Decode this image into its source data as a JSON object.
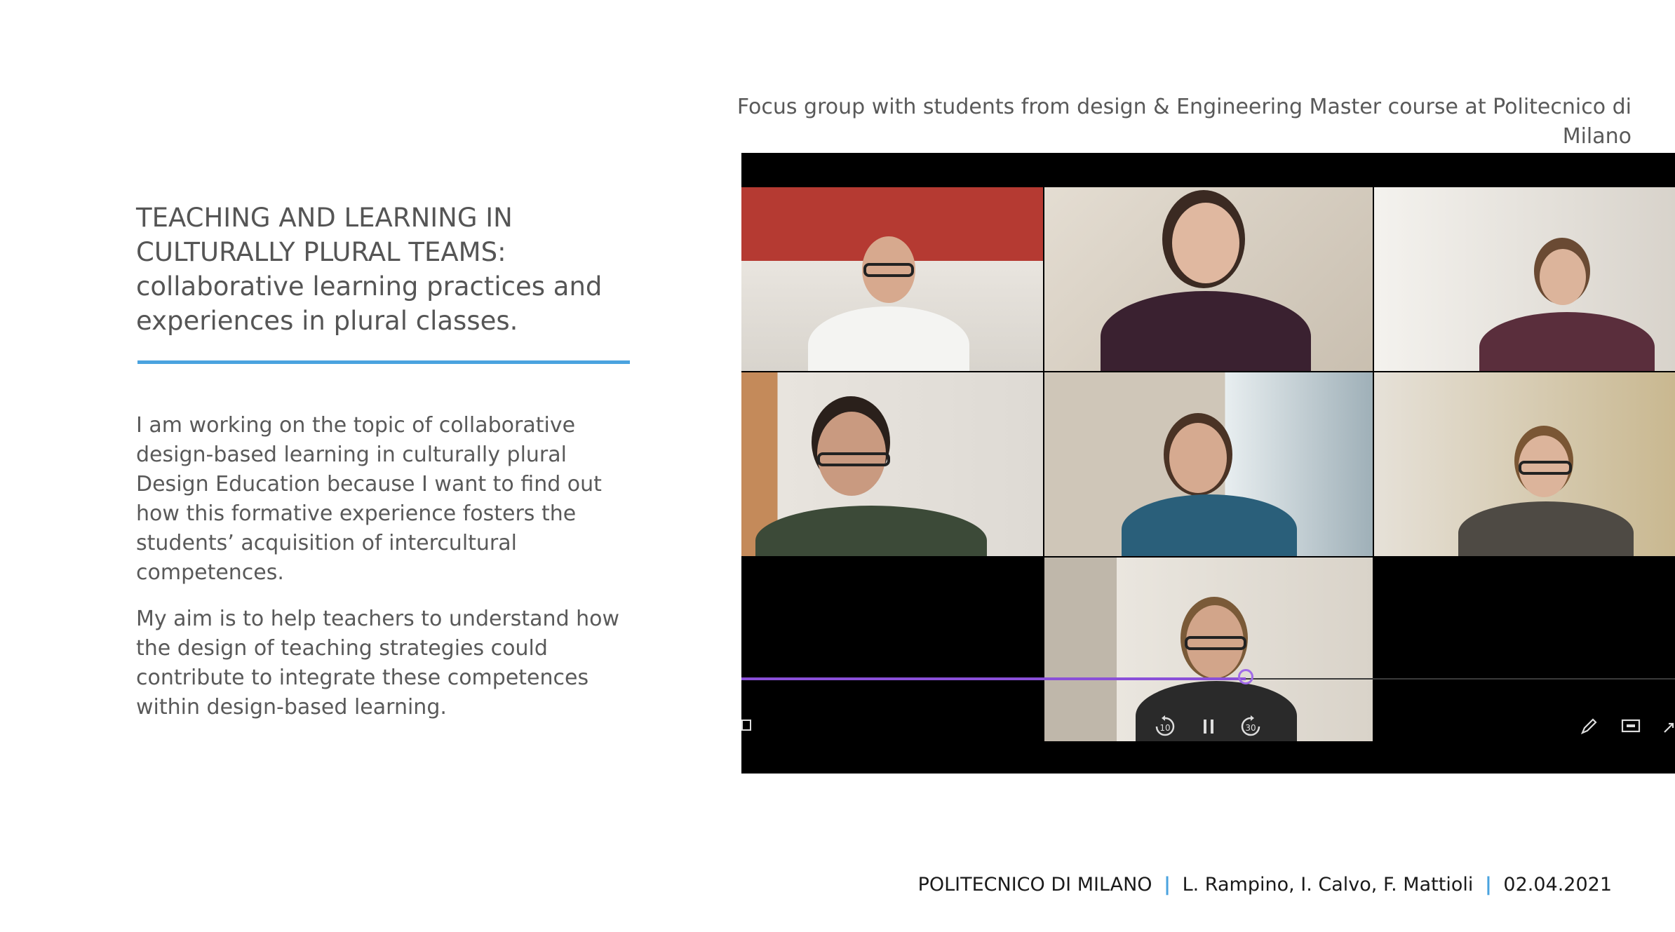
{
  "slide": {
    "title_line1": "TEACHING AND LEARNING IN",
    "title_line2": "CULTURALLY PLURAL TEAMS:",
    "title_line3": "collaborative learning practices and",
    "title_line4": "experiences in plural classes.",
    "paragraph1": "I am working on the topic of collaborative design-based learning in culturally plural Design Education because I want to find out how this formative experience fosters the students’ acquisition of intercultural competences.",
    "paragraph2": "My aim is to help teachers to understand how the design of teaching strategies could contribute to integrate these competences within design-based learning.",
    "caption_line1": "Focus group with students from design & Engineering Master course at Politecnico di",
    "caption_line2": "Milano"
  },
  "video": {
    "progress_fraction": 0.54,
    "controls": {
      "rewind_label": "10",
      "forward_label": "30",
      "rewind_icon": "rewind-10-icon",
      "pause_icon": "pause-icon",
      "forward_icon": "forward-30-icon",
      "pen_icon": "pen-icon",
      "captions_icon": "captions-icon",
      "expand_icon": "expand-icon",
      "subtitle_icon": "subtitle-icon"
    }
  },
  "footer": {
    "institution": "POLITECNICO DI MILANO",
    "authors": "L. Rampino, I. Calvo, F. Mattioli",
    "date": "02.04.2021",
    "separator": "|"
  }
}
